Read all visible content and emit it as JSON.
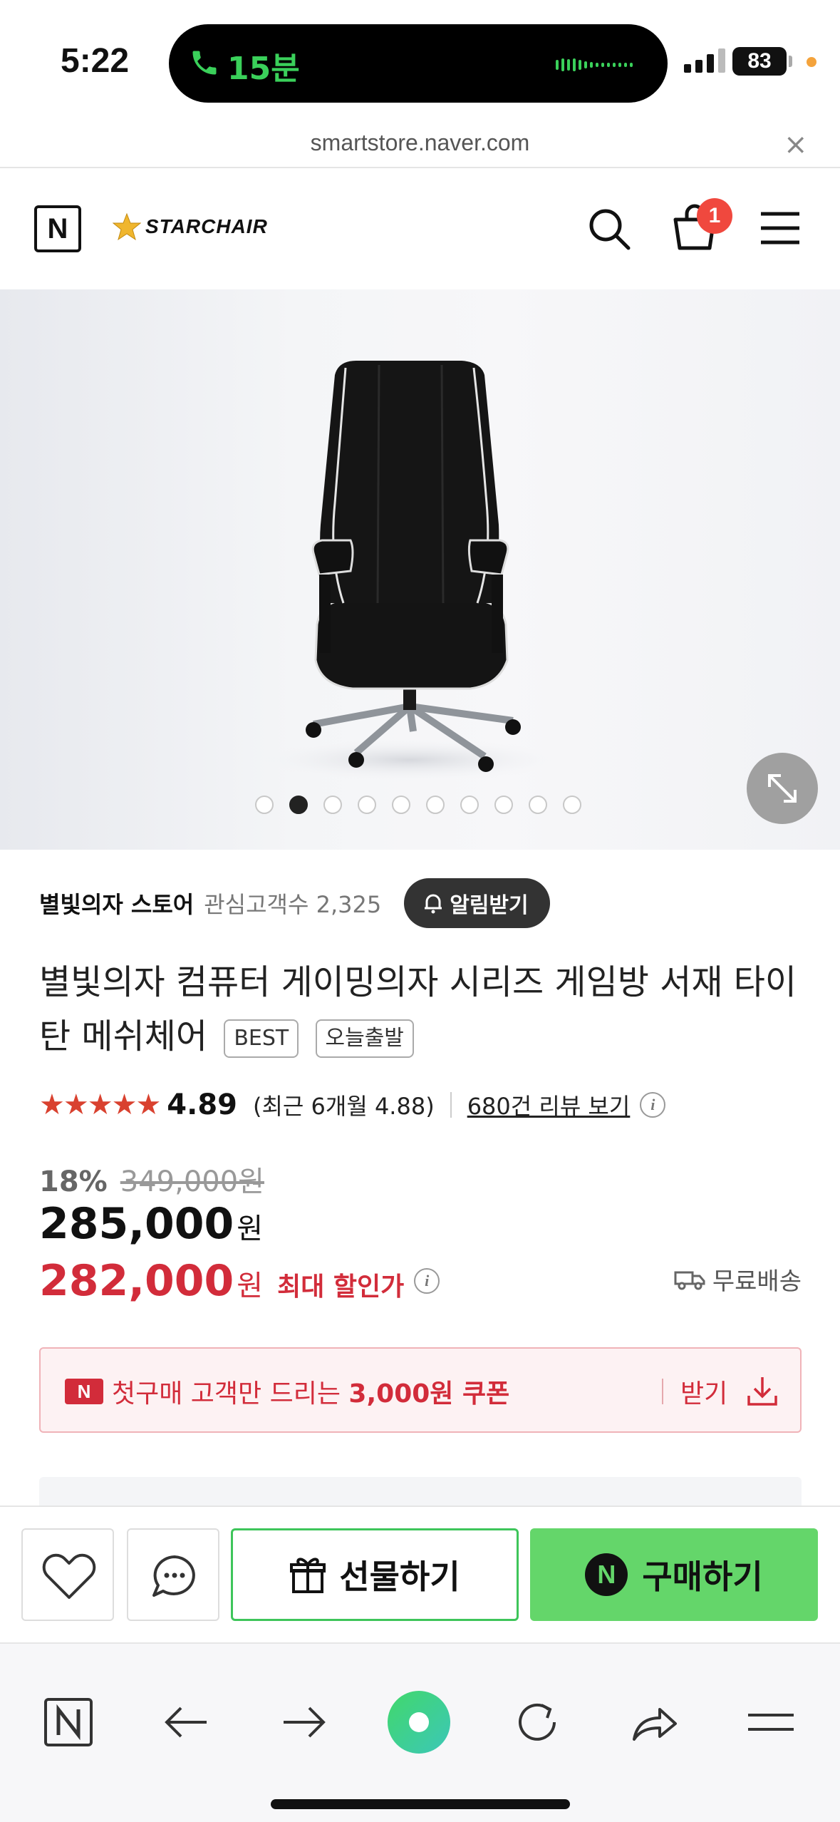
{
  "status_bar": {
    "time": "5:22",
    "call_duration": "15분",
    "battery": "83"
  },
  "browser": {
    "url": "smartstore.naver.com"
  },
  "header": {
    "logo_letter": "N",
    "brand": "STARCHAIR",
    "cart_count": "1"
  },
  "gallery": {
    "total_images": 10,
    "active_index": 1
  },
  "store": {
    "name": "별빛의자 스토어",
    "fans": "관심고객수 2,325",
    "alert_button": "알림받기"
  },
  "product": {
    "title": "별빛의자 컴퓨터 게이밍의자 시리즈 게임방 서재 타이탄 메쉬체어",
    "tags": [
      "BEST",
      "오늘출발"
    ],
    "stars": "★★★★★",
    "rating": "4.89",
    "recent_rating": "(최근 6개월 4.88)",
    "reviews_link": "680건 리뷰 보기",
    "discount_percent": "18%",
    "original_price": "349,000원",
    "price": "285,000",
    "currency": "원",
    "max_discount_price": "282,000",
    "max_discount_label": "최대 할인가",
    "shipping": "무료배송"
  },
  "coupon": {
    "badge": "N",
    "text_prefix": "첫구매 고객만 드리는 ",
    "text_bold": "3,000원 쿠폰",
    "action": "받기"
  },
  "buy_bar": {
    "gift_label": "선물하기",
    "buy_label": "구매하기",
    "buy_badge": "N"
  },
  "colors": {
    "naver_green": "#64d66a",
    "sale_red": "#d22c3a",
    "star_red": "#d9412f",
    "badge_red": "#f0483e"
  }
}
